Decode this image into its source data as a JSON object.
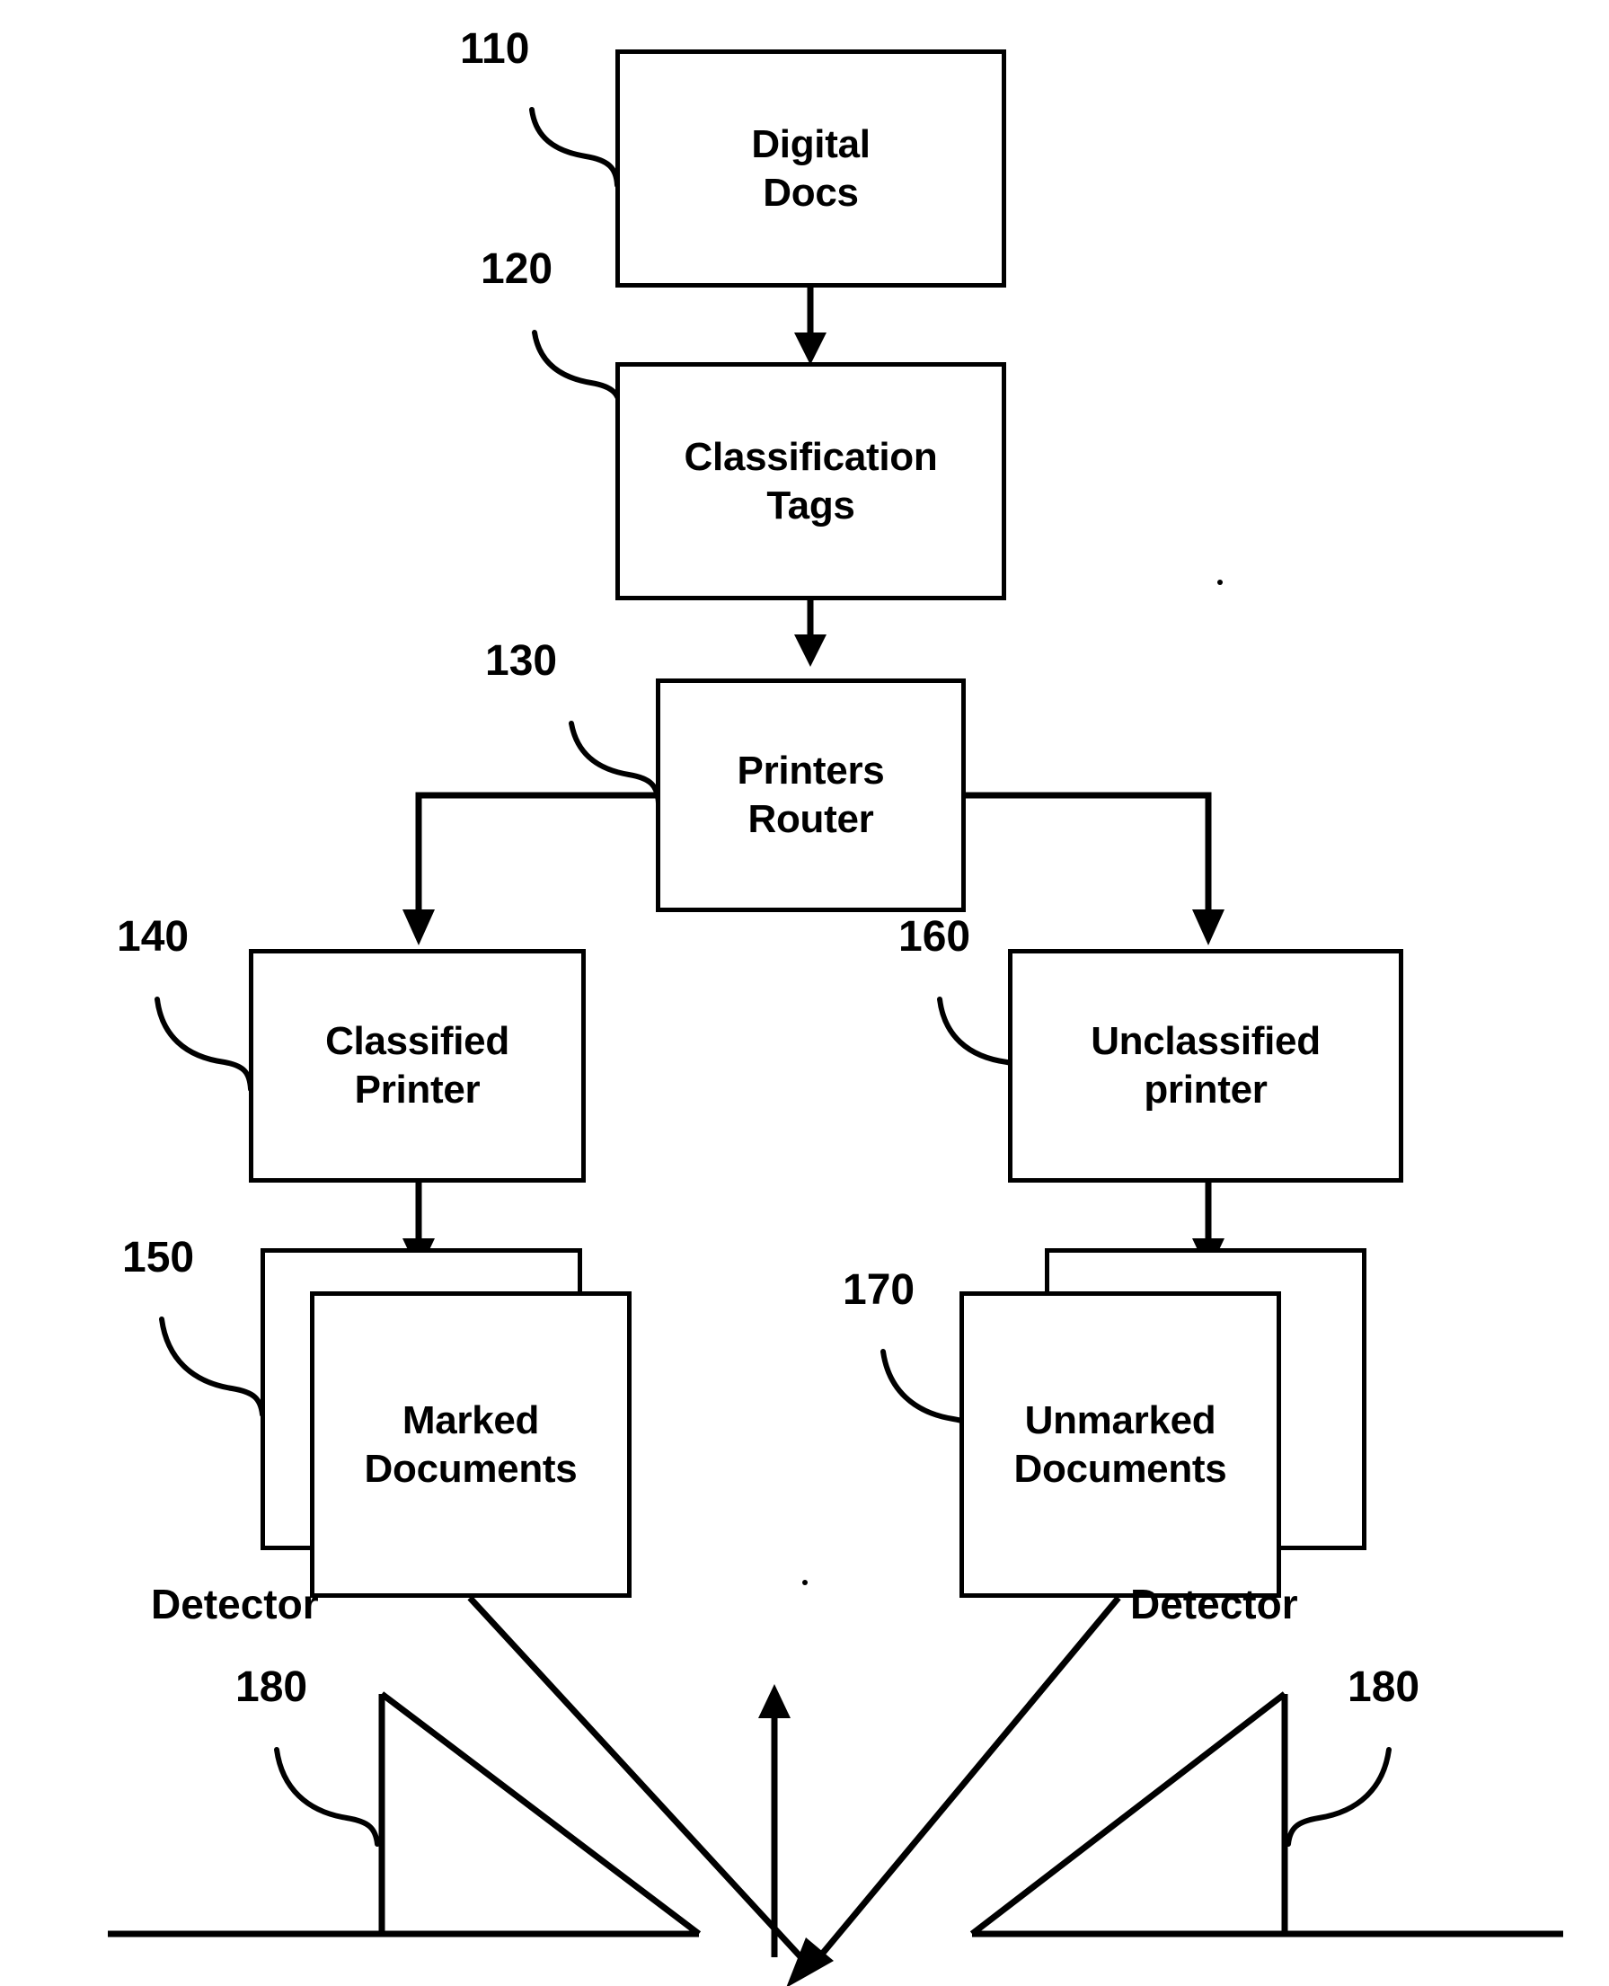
{
  "figure": {
    "type": "patent-flowchart",
    "background_color": "#ffffff",
    "line_color": "#000000"
  },
  "nodes": {
    "digital_docs": {
      "ref": "110",
      "label": "Digital\nDocs"
    },
    "classification_tags": {
      "ref": "120",
      "label": "Classification\nTags"
    },
    "printers_router": {
      "ref": "130",
      "label": "Printers\nRouter"
    },
    "classified_printer": {
      "ref": "140",
      "label": "Classified\nPrinter"
    },
    "marked_documents": {
      "ref": "150",
      "label": "Marked\nDocuments"
    },
    "unclassified_printer": {
      "ref": "160",
      "label": "Unclassified\nprinter"
    },
    "unmarked_documents": {
      "ref": "170",
      "label": "Unmarked\nDocuments"
    },
    "detector_left": {
      "ref": "180",
      "label": "Detector"
    },
    "detector_right": {
      "ref": "180",
      "label": "Detector"
    }
  },
  "flow": [
    {
      "from": "digital_docs",
      "to": "classification_tags"
    },
    {
      "from": "classification_tags",
      "to": "printers_router"
    },
    {
      "from": "printers_router",
      "to": "classified_printer"
    },
    {
      "from": "printers_router",
      "to": "unclassified_printer"
    },
    {
      "from": "classified_printer",
      "to": "marked_documents"
    },
    {
      "from": "unclassified_printer",
      "to": "unmarked_documents"
    },
    {
      "from": "marked_documents",
      "to": "detector_focus"
    },
    {
      "from": "unmarked_documents",
      "to": "detector_focus"
    }
  ]
}
